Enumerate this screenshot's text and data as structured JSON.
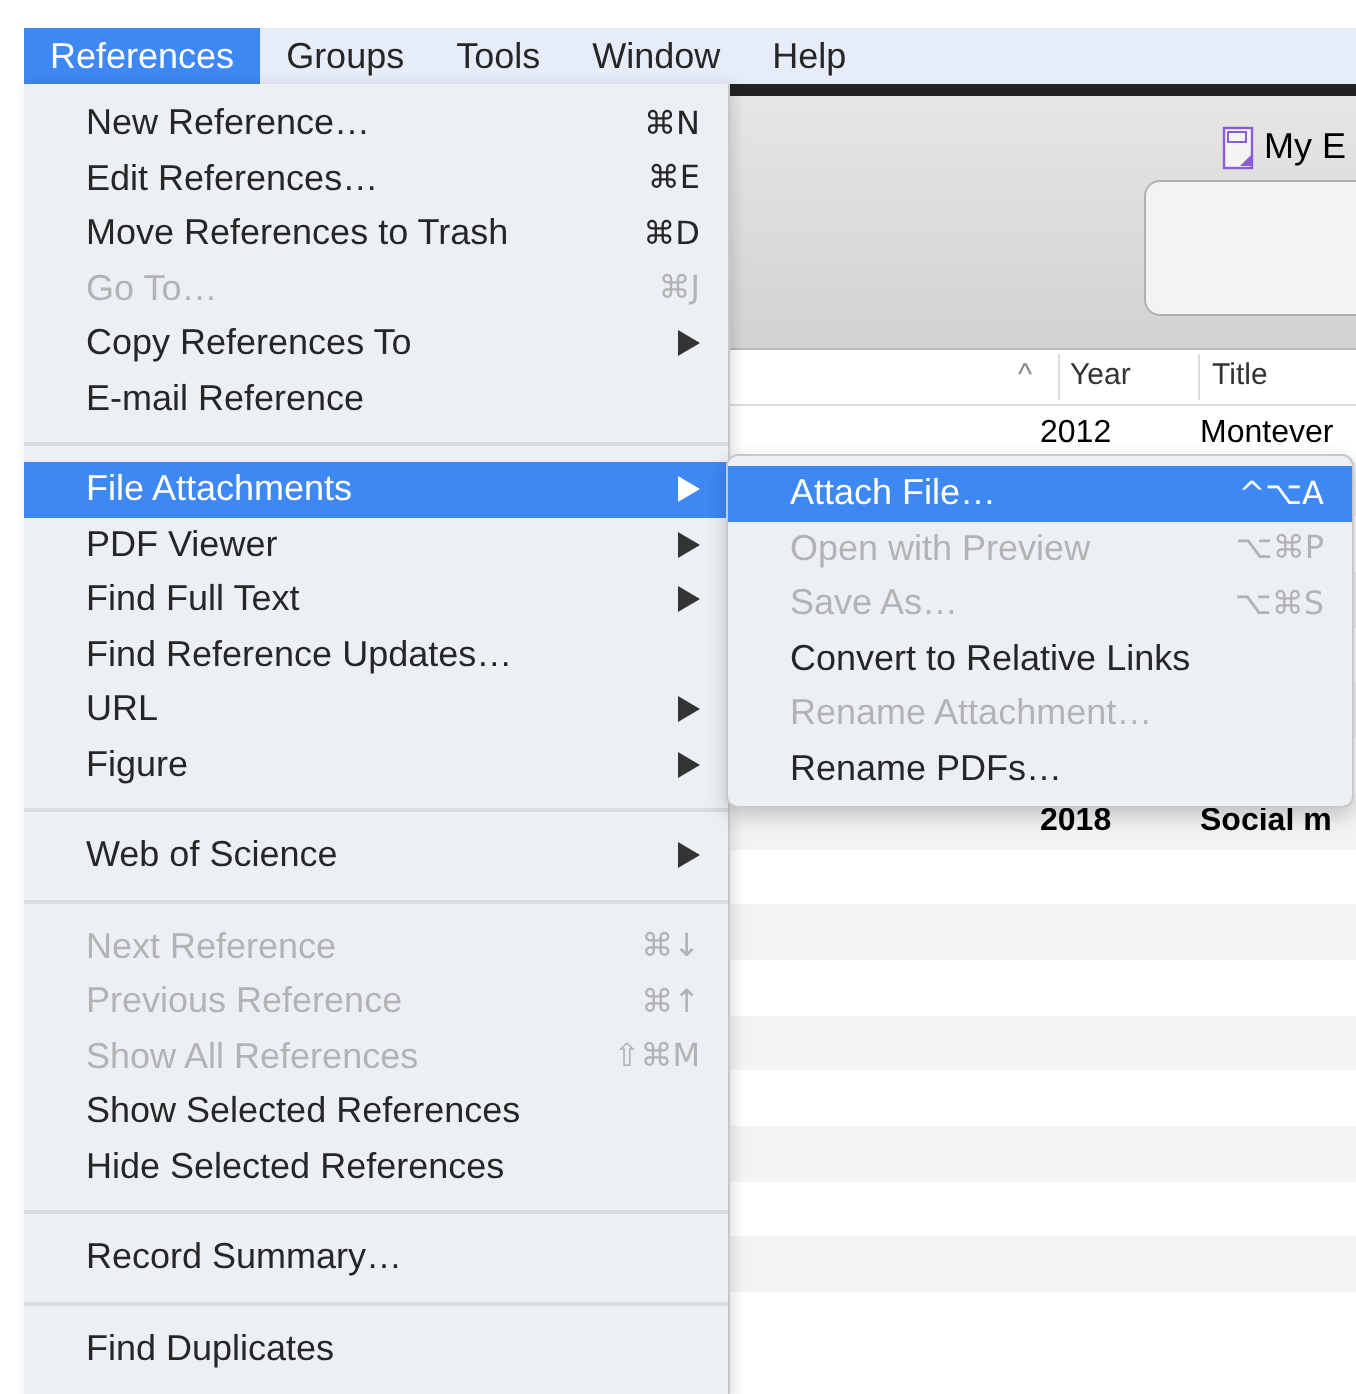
{
  "menubar": [
    {
      "label": "References",
      "selected": true
    },
    {
      "label": "Groups",
      "selected": false
    },
    {
      "label": "Tools",
      "selected": false
    },
    {
      "label": "Window",
      "selected": false
    },
    {
      "label": "Help",
      "selected": false
    }
  ],
  "background_window": {
    "library_title": "My E",
    "columns": [
      "Year",
      "Title"
    ],
    "sort_indicator": "^",
    "rows": [
      {
        "year": "2012",
        "title": "Montever",
        "bold": false
      },
      {
        "year": "2018",
        "title": "Social m",
        "bold": true
      }
    ]
  },
  "menu": {
    "sections": [
      [
        {
          "label": "New Reference…",
          "shortcut": "⌘N",
          "submenu": false,
          "disabled": false,
          "selected": false
        },
        {
          "label": "Edit References…",
          "shortcut": "⌘E",
          "submenu": false,
          "disabled": false,
          "selected": false
        },
        {
          "label": "Move References to Trash",
          "shortcut": "⌘D",
          "submenu": false,
          "disabled": false,
          "selected": false
        },
        {
          "label": "Go To…",
          "shortcut": "⌘J",
          "submenu": false,
          "disabled": true,
          "selected": false
        },
        {
          "label": "Copy References To",
          "submenu": true,
          "disabled": false,
          "selected": false
        },
        {
          "label": "E-mail Reference",
          "submenu": false,
          "disabled": false,
          "selected": false
        }
      ],
      [
        {
          "label": "File Attachments",
          "submenu": true,
          "disabled": false,
          "selected": true
        },
        {
          "label": "PDF Viewer",
          "submenu": true,
          "disabled": false,
          "selected": false
        },
        {
          "label": "Find Full Text",
          "submenu": true,
          "disabled": false,
          "selected": false
        },
        {
          "label": "Find Reference Updates…",
          "submenu": false,
          "disabled": false,
          "selected": false
        },
        {
          "label": "URL",
          "submenu": true,
          "disabled": false,
          "selected": false
        },
        {
          "label": "Figure",
          "submenu": true,
          "disabled": false,
          "selected": false
        }
      ],
      [
        {
          "label": "Web of Science",
          "submenu": true,
          "disabled": false,
          "selected": false
        }
      ],
      [
        {
          "label": "Next Reference",
          "shortcut": "⌘↓",
          "submenu": false,
          "disabled": true,
          "selected": false
        },
        {
          "label": "Previous Reference",
          "shortcut": "⌘↑",
          "submenu": false,
          "disabled": true,
          "selected": false
        },
        {
          "label": "Show All References",
          "shortcut": "⇧⌘M",
          "submenu": false,
          "disabled": true,
          "selected": false
        },
        {
          "label": "Show Selected References",
          "submenu": false,
          "disabled": false,
          "selected": false
        },
        {
          "label": "Hide Selected References",
          "submenu": false,
          "disabled": false,
          "selected": false
        }
      ],
      [
        {
          "label": "Record Summary…",
          "submenu": false,
          "disabled": false,
          "selected": false
        }
      ],
      [
        {
          "label": "Find Duplicates",
          "submenu": false,
          "disabled": false,
          "selected": false
        }
      ]
    ]
  },
  "submenu": {
    "items": [
      {
        "label": "Attach File…",
        "shortcut": "^⌥A",
        "disabled": false,
        "selected": true
      },
      {
        "label": "Open with Preview",
        "shortcut": "⌥⌘P",
        "disabled": true,
        "selected": false
      },
      {
        "label": "Save As…",
        "shortcut": "⌥⌘S",
        "disabled": true,
        "selected": false
      },
      {
        "label": "Convert to Relative Links",
        "disabled": false,
        "selected": false
      },
      {
        "label": "Rename Attachment…",
        "disabled": true,
        "selected": false
      },
      {
        "label": "Rename PDFs…",
        "disabled": false,
        "selected": false
      }
    ]
  }
}
